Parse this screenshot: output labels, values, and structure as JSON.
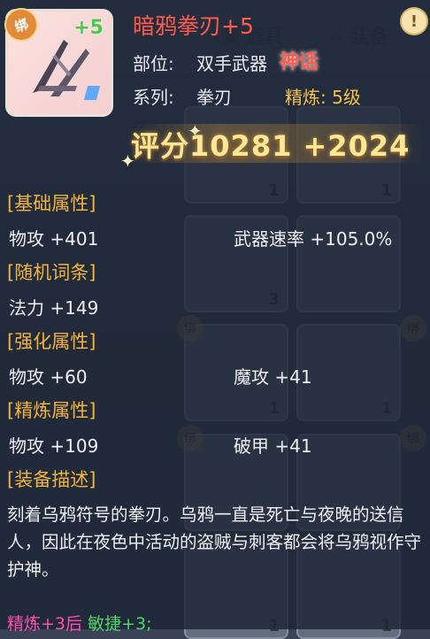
{
  "item": {
    "title": "暗鸦拳刃+5",
    "bind_badge": "绑",
    "plus_badge": "+5",
    "part_label": "部位:",
    "part_value": "双手武器",
    "quality": "神话",
    "series_label": "系列:",
    "series_value": "拳刃",
    "refine_label": "精炼:",
    "refine_value": "5级",
    "score_label": "评分",
    "score_value": "10281",
    "score_bonus": "+2024",
    "info_icon": "!"
  },
  "sections": {
    "basic": {
      "title": "[基础属性]",
      "stats": [
        {
          "text": "物攻 +401"
        },
        {
          "text": "武器速率 +105.0%"
        }
      ]
    },
    "random": {
      "title": "[随机词条]",
      "stats": [
        {
          "text": "法力 +149"
        }
      ]
    },
    "enhance": {
      "title": "[强化属性]",
      "stats": [
        {
          "text": "物攻 +60"
        },
        {
          "text": "魔攻 +41"
        }
      ]
    },
    "refine": {
      "title": "[精炼属性]",
      "stats": [
        {
          "text": "物攻 +109"
        },
        {
          "text": "破甲 +41"
        }
      ]
    },
    "description": {
      "title": "[装备描述]",
      "text": "刻着乌鸦符号的拳刃。乌鸦一直是死亡与夜晚的送信人，因此在夜色中活动的盗贼与刺客都会将乌鸦视作守护神。"
    }
  },
  "refine_bonus": {
    "label": "精炼+3后",
    "value": "敏捷+3;"
  },
  "background": {
    "tab_left": "道具",
    "tab_right": "装备",
    "slot_count_1": "1",
    "slot_count_3": "3",
    "mark": "绑"
  },
  "colors": {
    "title_red": "#ff5a4e",
    "section_gold": "#f0b43c",
    "bonus_pink": "#ff4fb0",
    "bonus_green": "#4fd36a"
  }
}
